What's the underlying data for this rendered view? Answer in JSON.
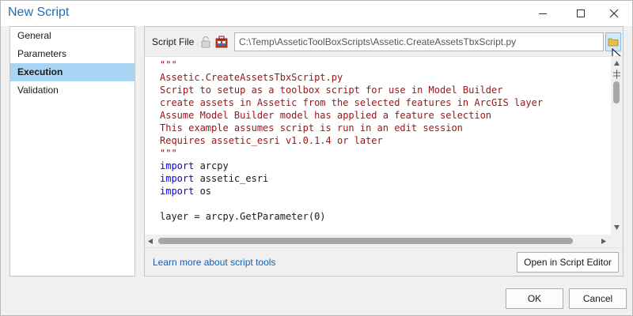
{
  "window": {
    "title": "New Script"
  },
  "sidebar": {
    "items": [
      {
        "label": "General",
        "active": false
      },
      {
        "label": "Parameters",
        "active": false
      },
      {
        "label": "Execution",
        "active": true
      },
      {
        "label": "Validation",
        "active": false
      }
    ]
  },
  "execution": {
    "script_file_label": "Script File",
    "script_file_path": "C:\\Temp\\AsseticToolBoxScripts\\Assetic.CreateAssetsTbxScript.py",
    "code_lines": [
      {
        "type": "doc",
        "text": "\"\"\""
      },
      {
        "type": "doc",
        "text": "Assetic.CreateAssetsTbxScript.py"
      },
      {
        "type": "doc",
        "text": "Script to setup as a toolbox script for use in Model Builder"
      },
      {
        "type": "doc",
        "text": "create assets in Assetic from the selected features in ArcGIS layer"
      },
      {
        "type": "doc",
        "text": "Assume Model Builder model has applied a feature selection"
      },
      {
        "type": "doc",
        "text": "This example assumes script is run in an edit session"
      },
      {
        "type": "doc",
        "text": "Requires assetic_esri v1.0.1.4 or later"
      },
      {
        "type": "doc",
        "text": "\"\"\""
      },
      {
        "type": "import",
        "keyword": "import",
        "text": " arcpy"
      },
      {
        "type": "import",
        "keyword": "import",
        "text": " assetic_esri"
      },
      {
        "type": "import",
        "keyword": "import",
        "text": " os"
      },
      {
        "type": "plain",
        "text": ""
      },
      {
        "type": "plain",
        "text": "layer = arcpy.GetParameter(0)"
      }
    ],
    "learn_more_link": "Learn more about script tools",
    "open_editor_button": "Open in Script Editor"
  },
  "footer": {
    "ok_label": "OK",
    "cancel_label": "Cancel"
  },
  "colors": {
    "title": "#1f6fb5",
    "active_item_bg": "#a9d4f3",
    "docstring": "#a31515",
    "keyword": "#0000ff",
    "link": "#1060b0"
  }
}
